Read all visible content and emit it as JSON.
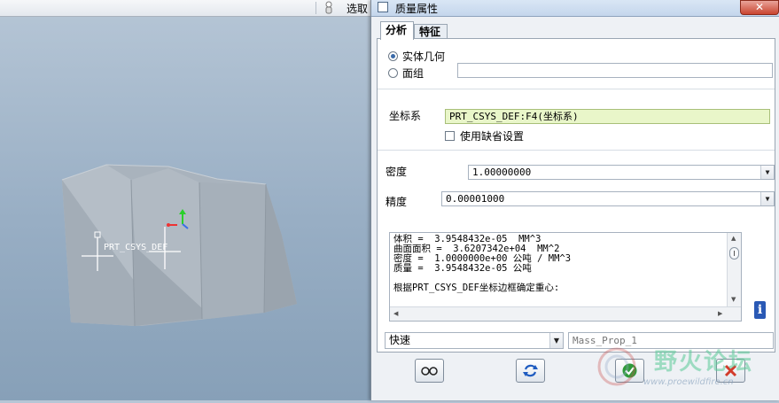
{
  "topbar": {
    "select_label": "选取"
  },
  "viewport": {
    "csys_label": "PRT_CSYS_DEF"
  },
  "dialog": {
    "title": "质量属性",
    "close_label": "✕",
    "tabs": [
      "分析",
      "特征"
    ],
    "solid_geometry_label": "实体几何",
    "quilt_label": "面组",
    "quilt_value": "",
    "csys_label": "坐标系",
    "csys_value": "PRT_CSYS_DEF:F4(坐标系)",
    "use_default_label": "使用缺省设置",
    "density_label": "密度",
    "density_value": "1.00000000",
    "accuracy_label": "精度",
    "accuracy_value": "0.00001000",
    "results": [
      "体积 =  3.9548432e-05  MM^3",
      "曲面面积 =  3.6207342e+04  MM^2",
      "密度 =  1.0000000e+00 公吨 / MM^3",
      "质量 =  3.9548432e-05 公吨",
      "",
      "根据PRT_CSYS_DEF坐标边框确定重心:"
    ],
    "mode_value": "快速",
    "output_name_placeholder": "Mass_Prop_1"
  },
  "watermark": {
    "name": "野火论坛",
    "url": "www.proewildfire.cn"
  },
  "colors": {
    "csys_field": "#e9f6c9",
    "info_icon": "#2a59b5",
    "cancel": "#d23b2a",
    "ok": "#2f9a3a"
  }
}
